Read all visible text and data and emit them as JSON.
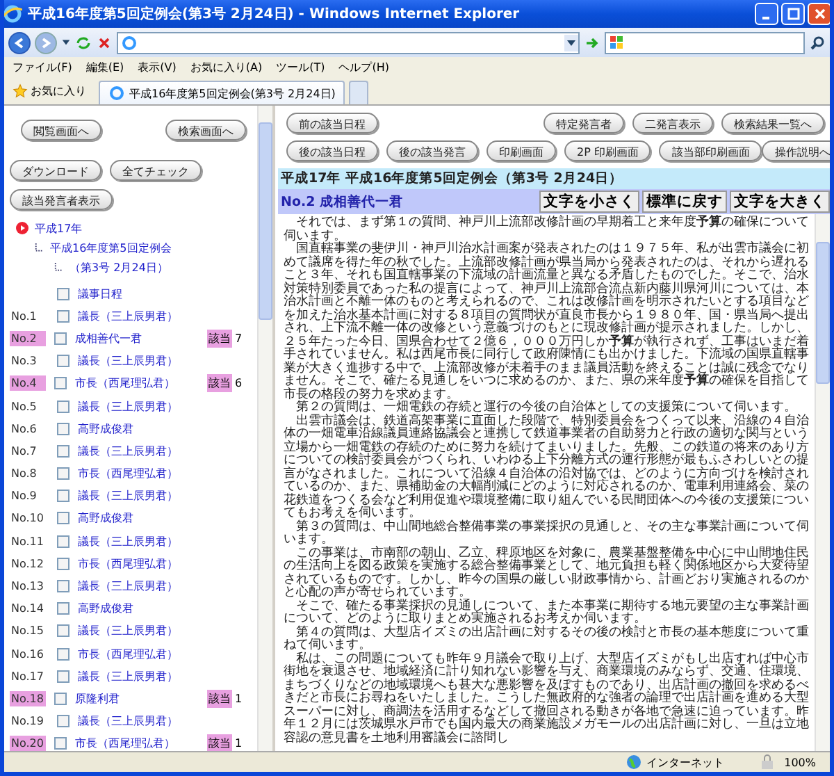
{
  "window": {
    "title": "平成16年度第5回定例会(第3号 2月24日) - Windows Internet Explorer"
  },
  "menu": [
    "ファイル(F)",
    "編集(E)",
    "表示(V)",
    "お気に入り(A)",
    "ツール(T)",
    "ヘルプ(H)"
  ],
  "favorites": {
    "label": "お気に入り"
  },
  "tabs": [
    {
      "label": "平成16年度第5回定例会(第3号 2月24日)",
      "selected": true
    }
  ],
  "left_panel": {
    "button_rows": [
      [
        [
          "閲覧画面へ"
        ],
        [
          "検索画面へ"
        ]
      ],
      [
        [
          "ダウンロード",
          "全てチェック"
        ]
      ],
      [
        [
          "該当発言者表示"
        ]
      ]
    ],
    "tree": {
      "label": "平成17年",
      "children": [
        {
          "label": "平成16年度第5回定例会",
          "children": [
            {
              "label": "（第3号 2月24日）"
            }
          ]
        }
      ]
    },
    "schedule": {
      "label": "議事日程",
      "checked": false
    },
    "speakers": [
      {
        "no": "No.1",
        "name": "議長（三上辰男君）",
        "checked": false,
        "highlighted": false
      },
      {
        "no": "No.2",
        "name": "成相善代一君",
        "checked": false,
        "highlighted": true,
        "hit": "該当",
        "count": "7"
      },
      {
        "no": "No.3",
        "name": "議長（三上辰男君）",
        "checked": false,
        "highlighted": false
      },
      {
        "no": "No.4",
        "name": "市長（西尾理弘君）",
        "checked": false,
        "highlighted": true,
        "hit": "該当",
        "count": "6"
      },
      {
        "no": "No.5",
        "name": "議長（三上辰男君）",
        "checked": false,
        "highlighted": false
      },
      {
        "no": "No.6",
        "name": "高野成俊君",
        "checked": false,
        "highlighted": false
      },
      {
        "no": "No.7",
        "name": "議長（三上辰男君）",
        "checked": false,
        "highlighted": false
      },
      {
        "no": "No.8",
        "name": "市長（西尾理弘君）",
        "checked": false,
        "highlighted": false
      },
      {
        "no": "No.9",
        "name": "議長（三上辰男君）",
        "checked": false,
        "highlighted": false
      },
      {
        "no": "No.10",
        "name": "高野成俊君",
        "checked": false,
        "highlighted": false
      },
      {
        "no": "No.11",
        "name": "議長（三上辰男君）",
        "checked": false,
        "highlighted": false
      },
      {
        "no": "No.12",
        "name": "市長（西尾理弘君）",
        "checked": false,
        "highlighted": false
      },
      {
        "no": "No.13",
        "name": "議長（三上辰男君）",
        "checked": false,
        "highlighted": false
      },
      {
        "no": "No.14",
        "name": "高野成俊君",
        "checked": false,
        "highlighted": false
      },
      {
        "no": "No.15",
        "name": "議長（三上辰男君）",
        "checked": false,
        "highlighted": false
      },
      {
        "no": "No.16",
        "name": "市長（西尾理弘君）",
        "checked": false,
        "highlighted": false
      },
      {
        "no": "No.17",
        "name": "議長（三上辰男君）",
        "checked": false,
        "highlighted": false
      },
      {
        "no": "No.18",
        "name": "原隆利君",
        "checked": false,
        "highlighted": true,
        "hit": "該当",
        "count": "1"
      },
      {
        "no": "No.19",
        "name": "議長（三上辰男君）",
        "checked": false,
        "highlighted": false
      },
      {
        "no": "No.20",
        "name": "市長（西尾理弘君）",
        "checked": false,
        "highlighted": true,
        "hit": "該当",
        "count": "1"
      }
    ]
  },
  "right_panel": {
    "button_rows": [
      [
        [
          "前の該当日程"
        ],
        [
          "特定発言者",
          "二発言表示",
          "検索結果一覧へ"
        ]
      ],
      [
        [
          "後の該当日程",
          "後の該当発言",
          "印刷画面",
          "2P 印刷画面",
          "該当部印刷画面"
        ],
        [
          "操作説明へ"
        ]
      ]
    ],
    "meeting_title": "平成17年 平成16年度第5回定例会（第3号 2月24日）",
    "speaker": "No.2 成相善代一君",
    "font_buttons": [
      "文字を小さく",
      "標準に戻す",
      "文字を大きく"
    ],
    "paragraphs": [
      "それでは、まず第１の質問、神戸川上流部改修計画の早期着工と来年度**予算**の確保について伺います。",
      "国直轄事業の斐伊川・神戸川治水計画案が発表されたのは１９７５年、私が出雲市議会に初めて議席を得た年の秋でした。上流部改修計画が県当局から発表されたのは、それから遅れること３年、それも国直轄事業の下流域の計画流量と異なる矛盾したものでした。そこで、治水対策特別委員であった私の提言によって、神戸川上流部合流点新内藤川県河川については、本治水計画と不離一体のものと考えられるので、これは改修計画を明示されたいとする項目などを加えた治水基本計画に対する８項目の質問状が直良市長から１９８０年、国・県当局へ提出され、上下流不離一体の改修という意義づけのもとに現改修計画が提示されました。しかし、２５年たった今日、国県合わせて２億６，０００万円しか**予算**が執行されず、工事はいまだ着手されていません。私は西尾市長に同行して政府陳情にも出かけました。下流域の国県直轄事業が大きく進捗する中で、上流部改修が未着手のまま議員活動を終えることは誠に残念でなりません。そこで、確たる見通しをいつに求めるのか、また、県の来年度**予算**の確保を目指して市長の格段の努力を求めます。",
      "第２の質問は、一畑電鉄の存続と運行の今後の自治体としての支援策について伺います。",
      "出雲市議会は、鉄道高架事業に直面した段階で、特別委員会をつくって以来、沿線の４自治体の一畑電車沿線議員連絡協議会と連携して鉄道事業者の自助努力と行政の適切な関与という立場から一畑電鉄の存続のために努力を続けてまいりました。先般、この鉄道の将来のあり方についての検討委員会がつくられ、いわゆる上下分離方式の運行形態が最もふさわしいとの提言がなされました。これについて沿線４自治体の沿対協では、どのように方向づけを検討されているのか、また、県補助金の大幅削減にどのように対応されるのか、電車利用連絡会、菜の花鉄道をつくる会など利用促進や環境整備に取り組んでいる民間団体への今後の支援策についてもお考えを伺います。",
      "第３の質問は、中山間地総合整備事業の事業採択の見通しと、その主な事業計画について伺います。",
      "この事業は、市南部の朝山、乙立、稗原地区を対象に、農業基盤整備を中心に中山間地住民の生活向上を図る政策を実施する総合整備事業として、地元負担も軽く関係地区から大変待望されているものです。しかし、昨今の国県の厳しい財政事情から、計画どおり実施されるのかと心配の声が寄せられています。",
      "そこで、確たる事業採択の見通しについて、また本事業に期待する地元要望の主な事業計画について、どのように取りまとめ実施されるお考えか伺います。",
      "第４の質問は、大型店イズミの出店計画に対するその後の検討と市長の基本態度について重ねて伺います。",
      "私は、この問題についても昨年９月議会で取り上げ、大型店イズミがもし出店すれば中心市街地を衰退させ、地域経済に計り知れない影響を与え、商業環境のみならず、交通、住環境、まちづくりなどの地域環境へも甚大な悪影響を及ぼすものであり、出店計画の撤回を求めるべきだと市長にお尋ねをいたしました。こうした無政府的な強者の論理で出店計画を進める大型スーパーに対し、商調法を活用するなどして撤回される動きが各地で急速に迫っています。昨年１２月には茨城県水戸市でも国内最大の商業施設メガモールの出店計画に対し、一旦は立地容認の意見書を土地利用審議会に諮問し"
    ]
  },
  "status_bar": {
    "zone": "インターネット",
    "zoom": "100%"
  }
}
